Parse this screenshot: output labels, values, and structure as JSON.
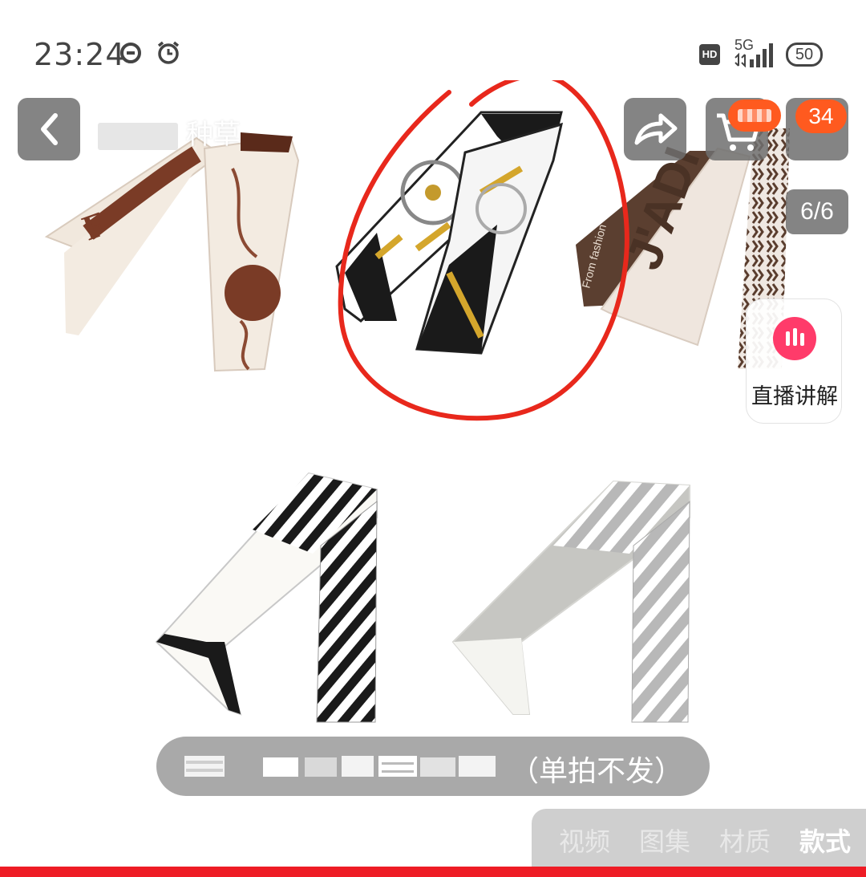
{
  "status_bar": {
    "time": "23:24",
    "hd_label": "HD",
    "network_label": "5G",
    "battery_level": "50",
    "icons": [
      "dnd-icon",
      "alarm-icon",
      "hd-badge",
      "signal-icon",
      "battery-icon"
    ]
  },
  "nav": {
    "title_suffix": "种草",
    "back_icon": "chevron-left-icon",
    "share_icon": "share-arrow-icon",
    "cart_icon": "cart-icon",
    "more_badge": "34"
  },
  "gallery": {
    "page_indicator": "6/6"
  },
  "live": {
    "label": "直播讲解",
    "icon": "live-bars-icon"
  },
  "caption": {
    "text": "（单拍不发）"
  },
  "tabs": [
    {
      "label": "视频",
      "active": false
    },
    {
      "label": "图集",
      "active": false
    },
    {
      "label": "材质",
      "active": false
    },
    {
      "label": "款式",
      "active": true
    }
  ],
  "colors": {
    "accent": "#ee1c25",
    "badge": "#ff5a1f",
    "annotation_circle": "#e8281c",
    "live": "#ff3b6a"
  }
}
